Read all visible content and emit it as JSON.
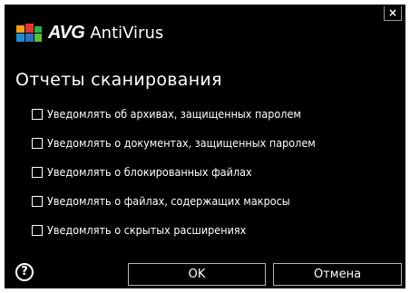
{
  "window": {
    "brand": "AVG",
    "product": "AntiVirus",
    "close_label": "×",
    "logo_icon": "avg-logo-icon"
  },
  "page": {
    "title": "Отчеты сканирования"
  },
  "options": [
    {
      "label": "Уведомлять об архивах, защищенных паролем",
      "checked": false
    },
    {
      "label": "Уведомлять о документах, защищенных паролем",
      "checked": false
    },
    {
      "label": "Уведомлять о блокированных файлах",
      "checked": false
    },
    {
      "label": "Уведомлять о файлах, содержащих макросы",
      "checked": false
    },
    {
      "label": "Уведомлять о скрытых расширениях",
      "checked": false
    }
  ],
  "footer": {
    "help_label": "?",
    "ok_label": "OK",
    "cancel_label": "Отмена"
  },
  "colors": {
    "background": "#000000",
    "text": "#ffffff",
    "button_border": "#b5b5b5"
  }
}
